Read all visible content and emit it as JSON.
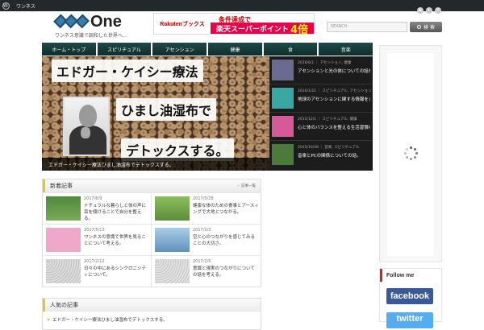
{
  "admin_bar": {
    "site_label": "ワンネス"
  },
  "header": {
    "logo_text": "One",
    "tagline": "ワンネス意識で調和した世界へ…",
    "banner": {
      "brand": "Rakutenブックス",
      "condition": "条件達成で",
      "main": "楽天スーパーポイント",
      "multiplier": "4倍"
    },
    "social_icons": [
      "rss-icon",
      "twitter-icon",
      "facebook-icon"
    ],
    "search": {
      "placeholder": "SEARCH",
      "button_label": "検 索"
    }
  },
  "nav": [
    "ホーム・トップ",
    "スピリチュアル",
    "アセンション",
    "健康",
    "食",
    "音楽"
  ],
  "slider": {
    "lines": [
      "エドガー・ケイシー療法",
      "ひまし油湿布で",
      "デトックスする。"
    ],
    "caption": "エドガー・ケイシー療法ひまし油湿布でデトックスする。"
  },
  "side_posts": [
    {
      "meta": "2016/6/1 ｜ アセンション, 健康",
      "title": "アセンションと光の体についての話を考える。",
      "thumb": "#6b6b8f"
    },
    {
      "meta": "2016/1/21 ｜ スピリチュアル, アセンション",
      "title": "地球のアセンションに関する情報をまとめる。",
      "thumb": "#3aa8a2"
    },
    {
      "meta": "2015/12/1 ｜ スピリチュアル, 健康",
      "title": "心と体のバランスを整える生活習慣の話。",
      "thumb": "#d65a9a"
    },
    {
      "meta": "2015/10/28 ｜ 音楽, スピリチュアル",
      "title": "音楽とPCの関係についての話。",
      "thumb": "#4b7b3a"
    }
  ],
  "new_articles": {
    "heading": "新着記事",
    "list_link": "記事一覧",
    "cards": [
      {
        "date": "2017/6/9",
        "title": "ナチュラルな暮らしと体の声に耳を傾けることで自分を整える。",
        "thumb": "#4f8a3a"
      },
      {
        "date": "2017/5/28",
        "title": "健康な体のための食事とアースィングで大地とつながる。",
        "thumb": "#6e9c4a"
      },
      {
        "date": "2017/5/13",
        "title": "ワンネスの意識で世界を見ることについて考える。",
        "thumb": "#f0a8c8"
      },
      {
        "date": "2017/3/3",
        "title": "空と心のつながりを感じてみることの大切さ。",
        "thumb": "#7fb6d8"
      },
      {
        "date": "2017/2/12",
        "title": "日々の中にあるシンクロニシティについて。",
        "thumb": "#d8d8d8"
      },
      {
        "date": "2017/2/5",
        "title": "意識と現実のつながりについての話を考える。",
        "thumb": "#cfcfcf"
      }
    ]
  },
  "recent": {
    "heading": "人気の記事",
    "items": [
      "エドガー・ケイシー療法ひまし油湿布でデトックスする。"
    ]
  },
  "follow": {
    "heading": "Follow me",
    "facebook": "facebook",
    "twitter": "twitter"
  },
  "colors": {
    "nav": "#1e4a47",
    "accent_yellow": "#e0cc1c",
    "accent_red": "#c12a2a",
    "facebook": "#3b5998",
    "twitter": "#55acee"
  }
}
